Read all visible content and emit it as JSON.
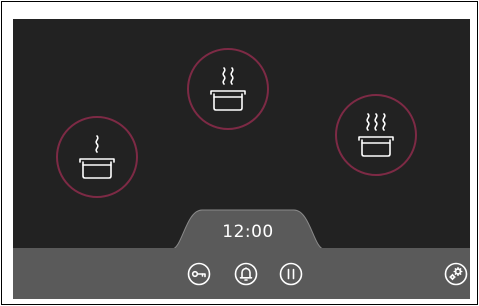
{
  "screen": {
    "name": "cooktop-control-panel"
  },
  "zones": [
    {
      "id": "zone-1",
      "state": "simmer",
      "steam_level": 1,
      "icon": "pot-steam-icon"
    },
    {
      "id": "zone-2",
      "state": "medium",
      "steam_level": 2,
      "icon": "pot-steam-icon"
    },
    {
      "id": "zone-3",
      "state": "boil",
      "steam_level": 3,
      "icon": "pot-steam-icon"
    }
  ],
  "timer": {
    "value": "12:00"
  },
  "controls": {
    "lock": {
      "icon": "key-lock-icon"
    },
    "alarm": {
      "icon": "bell-icon"
    },
    "pause": {
      "icon": "pause-icon"
    },
    "settings": {
      "icon": "gears-icon"
    }
  },
  "colors": {
    "cooktop_background": "#222222",
    "zone_ring": "#7d2a45",
    "control_bar": "#5a5a5a",
    "icon": "#ffffff"
  }
}
